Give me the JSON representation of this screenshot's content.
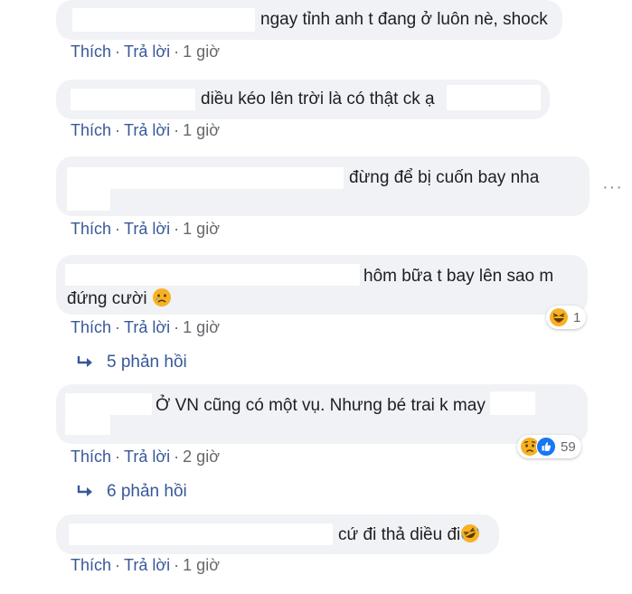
{
  "comments": [
    {
      "text": "ngay tỉnh anh t đang ở luôn nè, shock",
      "like": "Thích",
      "reply": "Trả lời",
      "time": "1 giờ"
    },
    {
      "text": "diều kéo lên trời là có thật ck ạ",
      "like": "Thích",
      "reply": "Trả lời",
      "time": "1 giờ"
    },
    {
      "text": "đừng để bị cuốn bay nha",
      "like": "Thích",
      "reply": "Trả lời",
      "time": "1 giờ"
    },
    {
      "text_line1": "hôm bữa t bay lên sao m",
      "text_line2": "đứng cười",
      "like": "Thích",
      "reply": "Trả lời",
      "time": "1 giờ",
      "reaction_count": "1",
      "replies": "5 phản hồi"
    },
    {
      "text": "Ở VN cũng có một vụ. Nhưng bé trai k may",
      "like": "Thích",
      "reply": "Trả lời",
      "time": "2 giờ",
      "reaction_count": "59",
      "replies": "6 phản hồi"
    },
    {
      "text": "cứ đi thả diều đi",
      "like": "Thích",
      "reply": "Trả lời",
      "time": "1 giờ"
    }
  ],
  "colors": {
    "link": "#385898",
    "bubble": "#f0f2f5",
    "meta": "#65676b",
    "like_blue": "#1877f2",
    "emoji_yellow": "#f7b125"
  },
  "icons": {
    "reply_arrow": "reply-arrow-icon",
    "haha": "haha-reaction-icon",
    "sad": "sad-reaction-icon",
    "like": "like-reaction-icon",
    "more": "more-options-icon"
  }
}
